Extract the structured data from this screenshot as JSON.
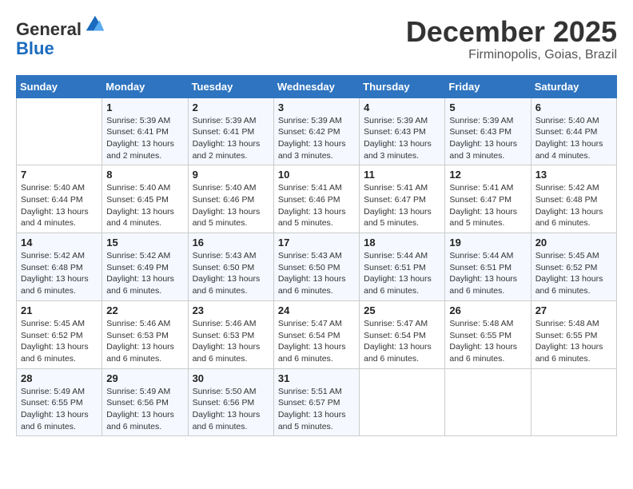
{
  "header": {
    "logo_line1": "General",
    "logo_line2": "Blue",
    "month": "December 2025",
    "location": "Firminopolis, Goias, Brazil"
  },
  "weekdays": [
    "Sunday",
    "Monday",
    "Tuesday",
    "Wednesday",
    "Thursday",
    "Friday",
    "Saturday"
  ],
  "weeks": [
    [
      {
        "day": "",
        "info": ""
      },
      {
        "day": "1",
        "info": "Sunrise: 5:39 AM\nSunset: 6:41 PM\nDaylight: 13 hours\nand 2 minutes."
      },
      {
        "day": "2",
        "info": "Sunrise: 5:39 AM\nSunset: 6:41 PM\nDaylight: 13 hours\nand 2 minutes."
      },
      {
        "day": "3",
        "info": "Sunrise: 5:39 AM\nSunset: 6:42 PM\nDaylight: 13 hours\nand 3 minutes."
      },
      {
        "day": "4",
        "info": "Sunrise: 5:39 AM\nSunset: 6:43 PM\nDaylight: 13 hours\nand 3 minutes."
      },
      {
        "day": "5",
        "info": "Sunrise: 5:39 AM\nSunset: 6:43 PM\nDaylight: 13 hours\nand 3 minutes."
      },
      {
        "day": "6",
        "info": "Sunrise: 5:40 AM\nSunset: 6:44 PM\nDaylight: 13 hours\nand 4 minutes."
      }
    ],
    [
      {
        "day": "7",
        "info": "Sunrise: 5:40 AM\nSunset: 6:44 PM\nDaylight: 13 hours\nand 4 minutes."
      },
      {
        "day": "8",
        "info": "Sunrise: 5:40 AM\nSunset: 6:45 PM\nDaylight: 13 hours\nand 4 minutes."
      },
      {
        "day": "9",
        "info": "Sunrise: 5:40 AM\nSunset: 6:46 PM\nDaylight: 13 hours\nand 5 minutes."
      },
      {
        "day": "10",
        "info": "Sunrise: 5:41 AM\nSunset: 6:46 PM\nDaylight: 13 hours\nand 5 minutes."
      },
      {
        "day": "11",
        "info": "Sunrise: 5:41 AM\nSunset: 6:47 PM\nDaylight: 13 hours\nand 5 minutes."
      },
      {
        "day": "12",
        "info": "Sunrise: 5:41 AM\nSunset: 6:47 PM\nDaylight: 13 hours\nand 5 minutes."
      },
      {
        "day": "13",
        "info": "Sunrise: 5:42 AM\nSunset: 6:48 PM\nDaylight: 13 hours\nand 6 minutes."
      }
    ],
    [
      {
        "day": "14",
        "info": "Sunrise: 5:42 AM\nSunset: 6:48 PM\nDaylight: 13 hours\nand 6 minutes."
      },
      {
        "day": "15",
        "info": "Sunrise: 5:42 AM\nSunset: 6:49 PM\nDaylight: 13 hours\nand 6 minutes."
      },
      {
        "day": "16",
        "info": "Sunrise: 5:43 AM\nSunset: 6:50 PM\nDaylight: 13 hours\nand 6 minutes."
      },
      {
        "day": "17",
        "info": "Sunrise: 5:43 AM\nSunset: 6:50 PM\nDaylight: 13 hours\nand 6 minutes."
      },
      {
        "day": "18",
        "info": "Sunrise: 5:44 AM\nSunset: 6:51 PM\nDaylight: 13 hours\nand 6 minutes."
      },
      {
        "day": "19",
        "info": "Sunrise: 5:44 AM\nSunset: 6:51 PM\nDaylight: 13 hours\nand 6 minutes."
      },
      {
        "day": "20",
        "info": "Sunrise: 5:45 AM\nSunset: 6:52 PM\nDaylight: 13 hours\nand 6 minutes."
      }
    ],
    [
      {
        "day": "21",
        "info": "Sunrise: 5:45 AM\nSunset: 6:52 PM\nDaylight: 13 hours\nand 6 minutes."
      },
      {
        "day": "22",
        "info": "Sunrise: 5:46 AM\nSunset: 6:53 PM\nDaylight: 13 hours\nand 6 minutes."
      },
      {
        "day": "23",
        "info": "Sunrise: 5:46 AM\nSunset: 6:53 PM\nDaylight: 13 hours\nand 6 minutes."
      },
      {
        "day": "24",
        "info": "Sunrise: 5:47 AM\nSunset: 6:54 PM\nDaylight: 13 hours\nand 6 minutes."
      },
      {
        "day": "25",
        "info": "Sunrise: 5:47 AM\nSunset: 6:54 PM\nDaylight: 13 hours\nand 6 minutes."
      },
      {
        "day": "26",
        "info": "Sunrise: 5:48 AM\nSunset: 6:55 PM\nDaylight: 13 hours\nand 6 minutes."
      },
      {
        "day": "27",
        "info": "Sunrise: 5:48 AM\nSunset: 6:55 PM\nDaylight: 13 hours\nand 6 minutes."
      }
    ],
    [
      {
        "day": "28",
        "info": "Sunrise: 5:49 AM\nSunset: 6:55 PM\nDaylight: 13 hours\nand 6 minutes."
      },
      {
        "day": "29",
        "info": "Sunrise: 5:49 AM\nSunset: 6:56 PM\nDaylight: 13 hours\nand 6 minutes."
      },
      {
        "day": "30",
        "info": "Sunrise: 5:50 AM\nSunset: 6:56 PM\nDaylight: 13 hours\nand 6 minutes."
      },
      {
        "day": "31",
        "info": "Sunrise: 5:51 AM\nSunset: 6:57 PM\nDaylight: 13 hours\nand 5 minutes."
      },
      {
        "day": "",
        "info": ""
      },
      {
        "day": "",
        "info": ""
      },
      {
        "day": "",
        "info": ""
      }
    ]
  ]
}
